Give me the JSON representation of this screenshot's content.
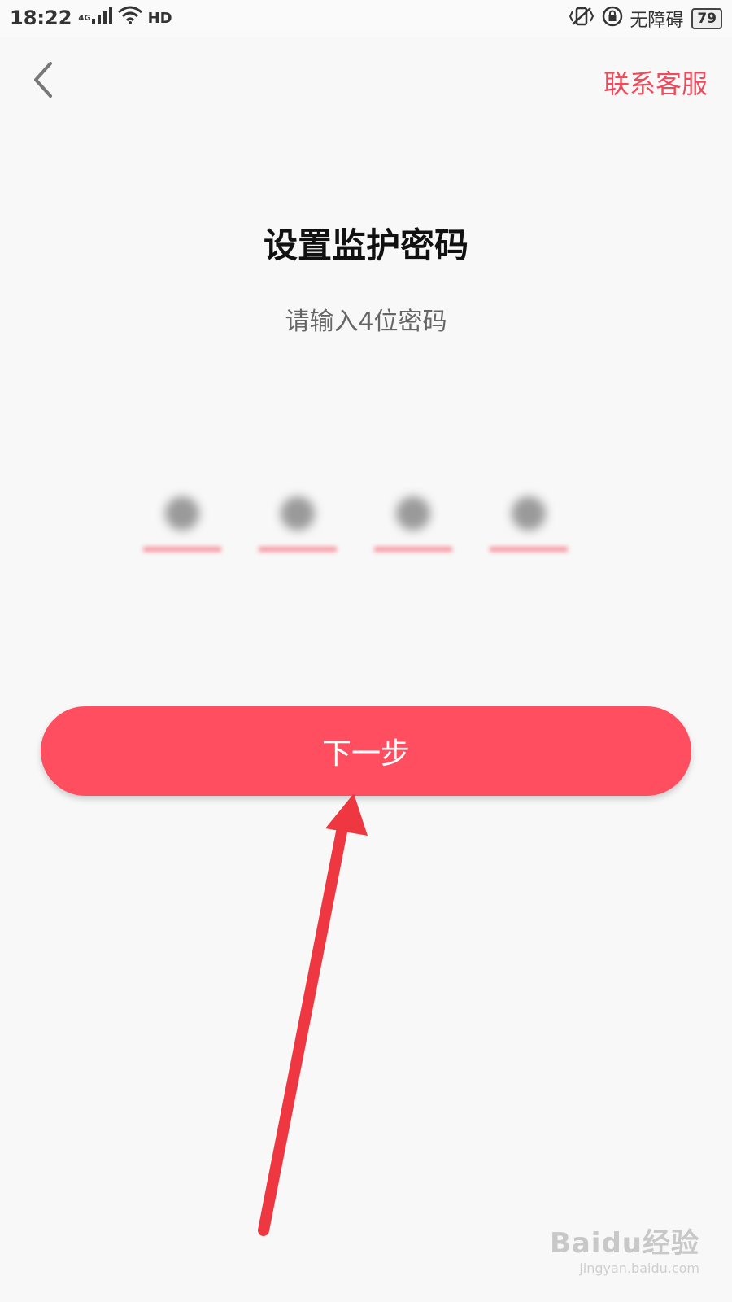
{
  "status_bar": {
    "time": "18:22",
    "network": "4G",
    "hd": "HD",
    "accessibility": "无障碍",
    "battery": "79"
  },
  "header": {
    "help_label": "联系客服"
  },
  "main": {
    "title": "设置监护密码",
    "subtitle": "请输入4位密码",
    "pin_length": 4,
    "next_label": "下一步"
  },
  "watermark": {
    "brand": "Baidu经验",
    "url": "jingyan.baidu.com"
  },
  "colors": {
    "accent": "#ff4e60",
    "link": "#f04a5a",
    "annotation_arrow": "#ee3740"
  },
  "icons": [
    "back-chevron-icon",
    "signal-icon",
    "wifi-icon",
    "hd-icon",
    "vibrate-icon",
    "lock-rotation-icon",
    "battery-icon"
  ]
}
